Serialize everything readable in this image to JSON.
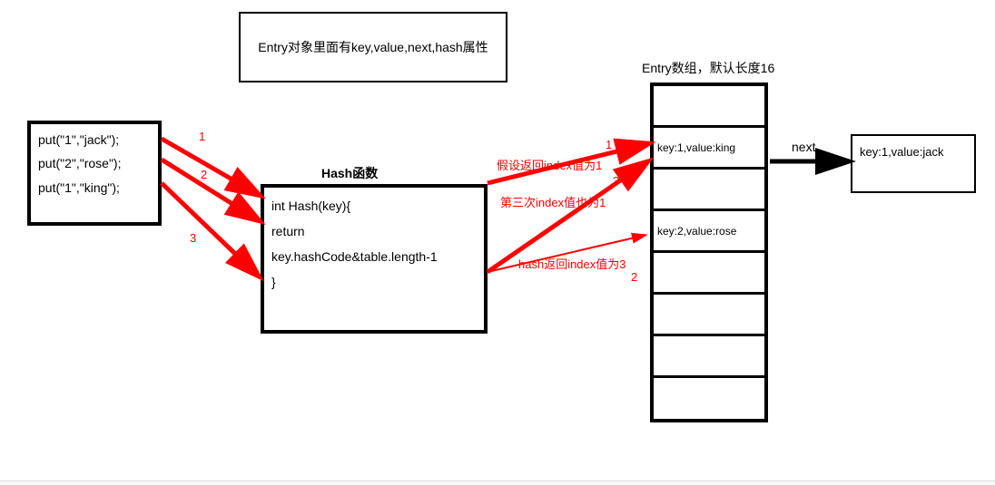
{
  "entry_title": "Entry对象里面有key,value,next,hash属性",
  "put_calls": {
    "line1": "put(\"1\",\"jack\");",
    "line2": "put(\"2\",\"rose\");",
    "line3": "put(\"1\",\"king\");"
  },
  "hash_label": "Hash函数",
  "hash_code": {
    "line1": "int Hash(key){",
    "line2": "return",
    "line3": "key.hashCode&table.length-1",
    "line4": "}"
  },
  "array_label": "Entry数组，默认长度16",
  "array_cells": {
    "cell0": "",
    "cell1": "key:1,value:king",
    "cell2": "",
    "cell3": "key:2,value:rose",
    "cell4": "",
    "cell5": "",
    "cell6": "",
    "cell7": ""
  },
  "next_label": "next",
  "linked_node": "key:1,value:jack",
  "labels": {
    "n1": "1",
    "n2": "2",
    "n3": "3",
    "annot1": "假设返回index值为1",
    "annot2": "hash返回index值为3",
    "annot3": "第三次index值也为1",
    "right1": "1",
    "right2": "2",
    "right3": "3"
  }
}
